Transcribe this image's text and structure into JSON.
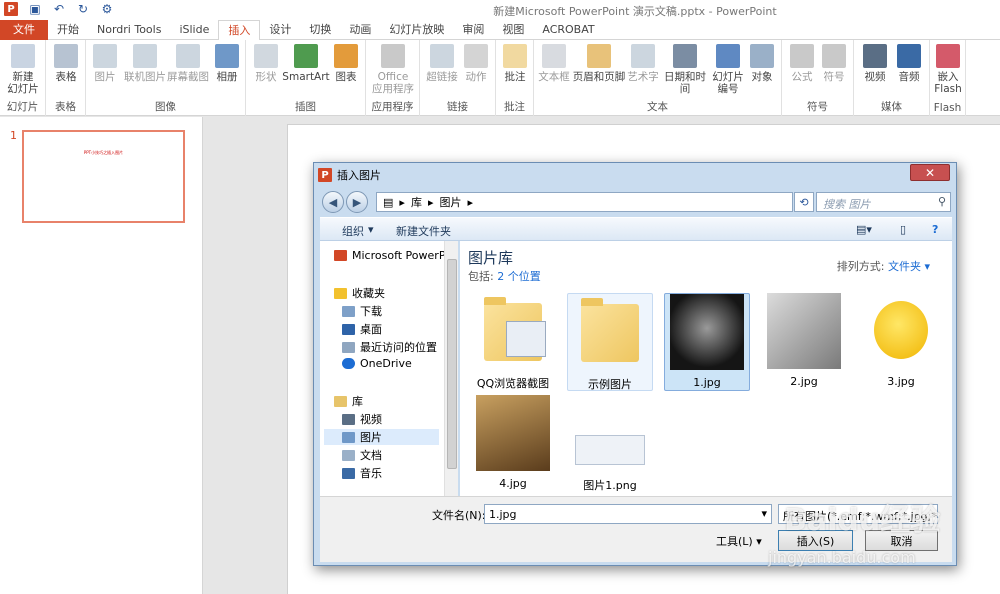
{
  "window": {
    "title": "新建Microsoft PowerPoint 演示文稿.pptx - PowerPoint",
    "logo": "P"
  },
  "quick_access": [
    "save-icon",
    "undo-icon",
    "redo-icon",
    "customize-icon"
  ],
  "tabs": [
    "文件",
    "开始",
    "Nordri Tools",
    "iSlide",
    "插入",
    "设计",
    "切换",
    "动画",
    "幻灯片放映",
    "审阅",
    "视图",
    "ACROBAT"
  ],
  "active_tab": "插入",
  "ribbon": {
    "groups": [
      {
        "label": "幻灯片",
        "buttons": [
          "新建\n幻灯片"
        ]
      },
      {
        "label": "表格",
        "buttons": [
          "表格"
        ]
      },
      {
        "label": "图像",
        "buttons": [
          "图片",
          "联机图片",
          "屏幕截图",
          "相册"
        ]
      },
      {
        "label": "插图",
        "buttons": [
          "形状",
          "SmartArt",
          "图表"
        ]
      },
      {
        "label": "应用程序",
        "buttons": [
          "Office\n应用程序"
        ]
      },
      {
        "label": "链接",
        "buttons": [
          "超链接",
          "动作"
        ]
      },
      {
        "label": "批注",
        "buttons": [
          "批注"
        ]
      },
      {
        "label": "文本",
        "buttons": [
          "文本框",
          "页眉和页脚",
          "艺术字",
          "日期和时间",
          "幻灯片\n编号",
          "对象"
        ]
      },
      {
        "label": "符号",
        "buttons": [
          "公式",
          "符号"
        ]
      },
      {
        "label": "媒体",
        "buttons": [
          "视频",
          "音频"
        ]
      },
      {
        "label": "Flash",
        "buttons": [
          "嵌入\nFlash"
        ]
      }
    ]
  },
  "slides": {
    "number": "1",
    "thumb_text": "PPT小技巧之插入图片"
  },
  "dialog": {
    "title": "插入图片",
    "address": [
      "库",
      "图片"
    ],
    "search_placeholder": "搜索 图片",
    "organize": "组织",
    "new_folder": "新建文件夹",
    "nav": {
      "items": [
        "Microsoft PowerPoi",
        "收藏夹",
        "下载",
        "桌面",
        "最近访问的位置",
        "OneDrive",
        "库",
        "视频",
        "图片",
        "文档",
        "音乐"
      ],
      "selected": "图片"
    },
    "library": {
      "title": "图片库",
      "includes_label": "包括:",
      "includes_value": "2 个位置",
      "sort_label": "排列方式:",
      "sort_value": "文件夹"
    },
    "files": [
      "QQ浏览器截图",
      "示例图片",
      "1.jpg",
      "2.jpg",
      "3.jpg",
      "4.jpg",
      "图片1.png"
    ],
    "selected_file": "1.jpg",
    "filename_label": "文件名(N):",
    "filename_value": "1.jpg",
    "filetype": "所有图片(*.emf;*.wmf;*.jpg;*.jp",
    "tools": "工具(L)",
    "insert": "插入(S)",
    "cancel": "取消"
  },
  "watermark": {
    "line1": "Baidu经验",
    "line2": "jingyan.baidu.com"
  }
}
